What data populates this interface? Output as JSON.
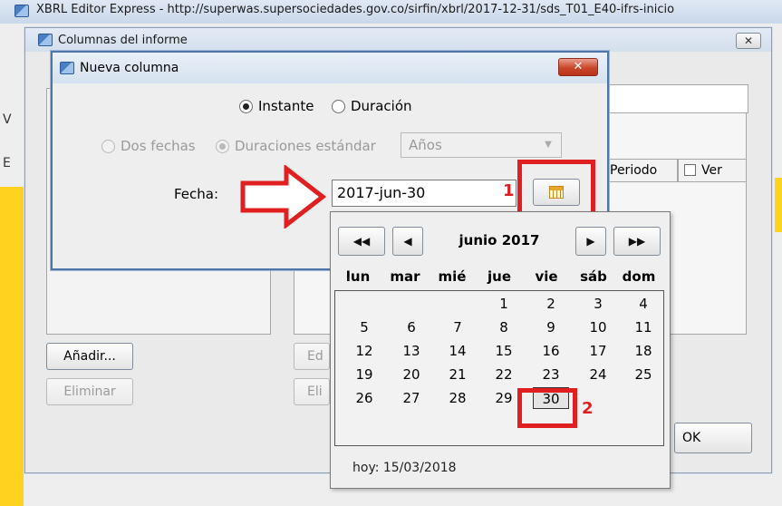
{
  "main_window": {
    "title": "XBRL Editor Express - http://superwas.supersociedades.gov.co/sirfin/xbrl/2017-12-31/sds_T01_E40-ifrs-inicio",
    "side_letter_1": "V",
    "side_letter_2": "E"
  },
  "columnas_dialog": {
    "title": "Columnas del informe",
    "close_label": "✕",
    "table_headers": {
      "periodo": "Periodo",
      "ver": "Ver"
    },
    "buttons": {
      "anadir": "Añadir...",
      "eliminar": "Eliminar",
      "editar": "Ed",
      "eliminar_right": "Eli",
      "ok": "OK"
    }
  },
  "nueva_columna_dialog": {
    "title": "Nueva columna",
    "close_label": "✕",
    "period_type": {
      "instante": "Instante",
      "duracion": "Duración",
      "selected": "instante"
    },
    "duration_mode": {
      "dos_fechas": "Dos fechas",
      "duraciones_estandar": "Duraciones estándar",
      "selected": "duraciones_estandar",
      "select_value": "Años"
    },
    "fecha_label": "Fecha:",
    "fecha_value": "2017-jun-30"
  },
  "annotations": {
    "step_1": "1",
    "step_2": "2"
  },
  "calendar": {
    "month_label": "junio 2017",
    "nav": {
      "prev_year": "◀◀",
      "prev_month": "◀",
      "next_month": "▶",
      "next_year": "▶▶"
    },
    "weekdays": [
      "lun",
      "mar",
      "mié",
      "jue",
      "vie",
      "sáb",
      "dom"
    ],
    "weeks": [
      [
        "",
        "",
        "",
        "1",
        "2",
        "3",
        "4"
      ],
      [
        "5",
        "6",
        "7",
        "8",
        "9",
        "10",
        "11"
      ],
      [
        "12",
        "13",
        "14",
        "15",
        "16",
        "17",
        "18"
      ],
      [
        "19",
        "20",
        "21",
        "22",
        "23",
        "24",
        "25"
      ],
      [
        "26",
        "27",
        "28",
        "29",
        "30",
        "",
        ""
      ]
    ],
    "selected_day": "30",
    "today_label": "hoy: 15/03/2018"
  },
  "colors": {
    "annotation_red": "#e02020",
    "side_yellow": "#ffd21f",
    "dialog_border": "#4f76a8"
  }
}
